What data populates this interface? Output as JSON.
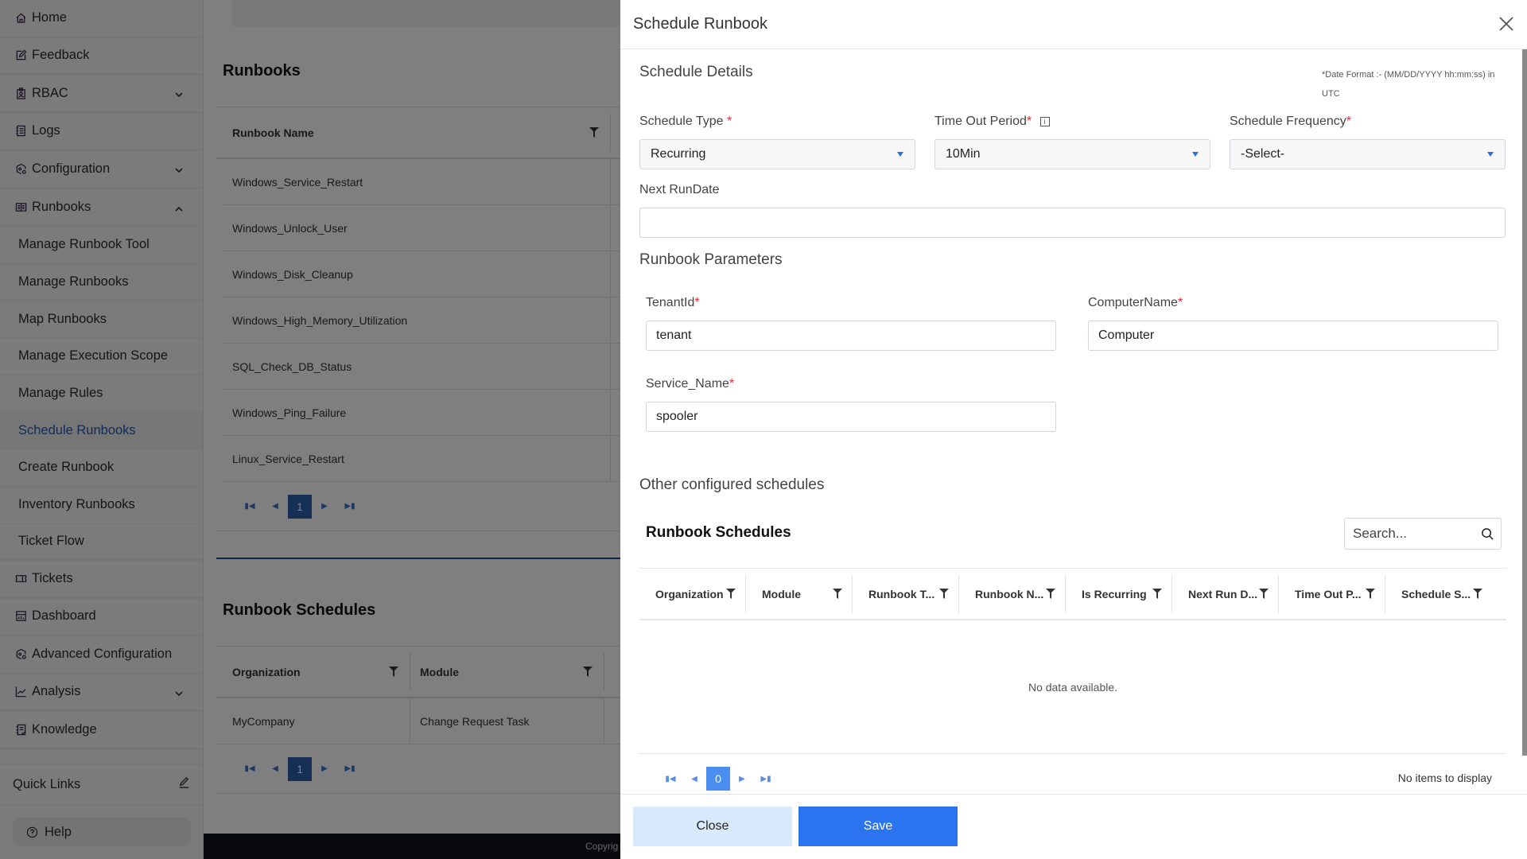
{
  "sidebar": {
    "items": [
      {
        "label": "Home",
        "icon": "home-icon"
      },
      {
        "label": "Feedback",
        "icon": "edit-icon"
      },
      {
        "label": "RBAC",
        "icon": "badge-icon",
        "expandable": true
      },
      {
        "label": "Logs",
        "icon": "log-icon"
      },
      {
        "label": "Configuration",
        "icon": "config-icon",
        "expandable": true
      },
      {
        "label": "Runbooks",
        "icon": "runbook-icon",
        "expanded": true
      }
    ],
    "runbook_subitems": [
      {
        "label": "Manage Runbook Tool"
      },
      {
        "label": "Manage Runbooks"
      },
      {
        "label": "Map Runbooks"
      },
      {
        "label": "Manage Execution Scope"
      },
      {
        "label": "Manage Rules"
      },
      {
        "label": "Schedule Runbooks",
        "active": true
      },
      {
        "label": "Create Runbook"
      },
      {
        "label": "Inventory Runbooks"
      },
      {
        "label": "Ticket Flow"
      }
    ],
    "lower_items": [
      {
        "label": "Tickets",
        "icon": "ticket-icon"
      },
      {
        "label": "Dashboard",
        "icon": "dashboard-icon"
      },
      {
        "label": "Advanced Configuration",
        "icon": "config-icon"
      },
      {
        "label": "Analysis",
        "icon": "chart-icon",
        "expandable": true
      },
      {
        "label": "Knowledge",
        "icon": "knowledge-icon"
      }
    ],
    "quick_links_label": "Quick Links",
    "help_label": "Help"
  },
  "background": {
    "runbooks_title": "Runbooks",
    "runbooks_column": "Runbook Name",
    "runbooks": [
      "Windows_Service_Restart",
      "Windows_Unlock_User",
      "Windows_Disk_Cleanup",
      "Windows_High_Memory_Utilization",
      "SQL_Check_DB_Status",
      "Windows_Ping_Failure",
      "Linux_Service_Restart"
    ],
    "runbooks_page": "1",
    "schedules_title": "Runbook Schedules",
    "schedules_columns": [
      "Organization",
      "Module"
    ],
    "schedules_rows": [
      [
        "MyCompany",
        "Change Request Task"
      ]
    ],
    "schedules_page": "1",
    "footer_text": "Copyrig"
  },
  "drawer": {
    "title": "Schedule Runbook",
    "schedule_details_heading": "Schedule Details",
    "date_note": "*Date Format :- (MM/DD/YYYY hh:mm:ss) in UTC",
    "schedule_type": {
      "label": "Schedule Type",
      "value": "Recurring"
    },
    "timeout_period": {
      "label": "Time Out Period",
      "value": "10Min"
    },
    "schedule_frequency": {
      "label": "Schedule Frequency",
      "value": "-Select-"
    },
    "next_run_date": {
      "label": "Next RunDate",
      "value": ""
    },
    "params_heading": "Runbook Parameters",
    "params": {
      "tenant_id": {
        "label": "TenantId",
        "value": "tenant"
      },
      "computer_name": {
        "label": "ComputerName",
        "value": "Computer"
      },
      "service_name": {
        "label": "Service_Name",
        "value": "spooler"
      }
    },
    "other_heading": "Other configured schedules",
    "grid": {
      "title": "Runbook Schedules",
      "search_placeholder": "Search...",
      "columns": [
        "Organization",
        "Module",
        "Runbook T...",
        "Runbook N...",
        "Is Recurring",
        "Next Run D...",
        "Time Out P...",
        "Schedule S..."
      ],
      "empty_text": "No data available.",
      "page": "0",
      "items_text": "No items to display"
    },
    "close_label": "Close",
    "save_label": "Save",
    "required_mark": "*"
  },
  "colors": {
    "primary": "#2a74ef",
    "close_button_bg": "#d8eafb",
    "active_nav": "#2558b0",
    "required": "#d9303a"
  }
}
